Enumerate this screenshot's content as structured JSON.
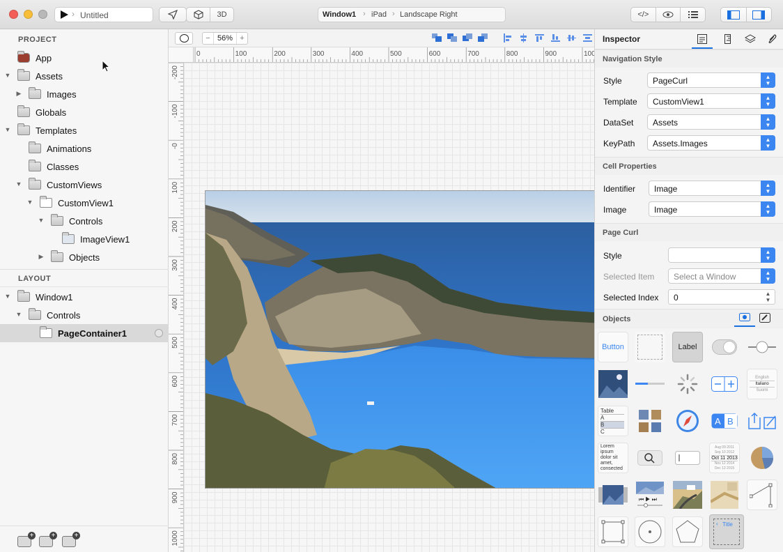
{
  "titlebar": {
    "document": "Untitled",
    "mode_3d": "3D",
    "breadcrumb": [
      "Window1",
      "iPad",
      "Landscape Right"
    ]
  },
  "left": {
    "project_header": "PROJECT",
    "layout_header": "LAYOUT",
    "project_items": [
      {
        "label": "App",
        "indent": 0,
        "tri": ""
      },
      {
        "label": "Assets",
        "indent": 0,
        "tri": "down"
      },
      {
        "label": "Images",
        "indent": 1,
        "tri": "right"
      },
      {
        "label": "Globals",
        "indent": 0,
        "tri": ""
      },
      {
        "label": "Templates",
        "indent": 0,
        "tri": "down"
      },
      {
        "label": "Animations",
        "indent": 1,
        "tri": ""
      },
      {
        "label": "Classes",
        "indent": 1,
        "tri": ""
      },
      {
        "label": "CustomViews",
        "indent": 1,
        "tri": "down"
      },
      {
        "label": "CustomView1",
        "indent": 2,
        "tri": "down"
      },
      {
        "label": "Controls",
        "indent": 3,
        "tri": "down"
      },
      {
        "label": "ImageView1",
        "indent": 4,
        "tri": ""
      },
      {
        "label": "Objects",
        "indent": 3,
        "tri": "right"
      }
    ],
    "layout_items": [
      {
        "label": "Window1",
        "indent": 0,
        "tri": "down"
      },
      {
        "label": "Controls",
        "indent": 1,
        "tri": "down"
      },
      {
        "label": "PageContainer1",
        "indent": 2,
        "tri": "",
        "selected": true
      }
    ]
  },
  "canvas": {
    "zoom": "56%",
    "ruler_top": [
      "0",
      "100",
      "200",
      "300",
      "400",
      "500",
      "600",
      "700",
      "800",
      "900",
      "100"
    ],
    "ruler_left": [
      "-200",
      "-100",
      "-0",
      "100",
      "200",
      "300",
      "400",
      "500",
      "600",
      "700",
      "800",
      "900",
      "1000"
    ]
  },
  "inspector": {
    "title": "Inspector",
    "nav_style_header": "Navigation Style",
    "nav_props": [
      {
        "label": "Style",
        "value": "PageCurl"
      },
      {
        "label": "Template",
        "value": "CustomView1"
      },
      {
        "label": "DataSet",
        "value": "Assets"
      },
      {
        "label": "KeyPath",
        "value": "Assets.Images"
      }
    ],
    "cell_header": "Cell Properties",
    "cell_props": [
      {
        "label": "Identifier",
        "value": "Image"
      },
      {
        "label": "Image",
        "value": "Image"
      }
    ],
    "curl_header": "Page Curl",
    "curl_props": [
      {
        "label": "Style",
        "value": ""
      },
      {
        "label": "Selected Item",
        "value": "Select a Window"
      },
      {
        "label": "Selected Index",
        "value": "0"
      }
    ],
    "objects_header": "Objects",
    "objects": {
      "button_label": "Button",
      "label_label": "Label",
      "table_lines": [
        "Table",
        "A",
        "B",
        "C"
      ],
      "picker_lines": [
        "English",
        "Italiano",
        "Suomi"
      ],
      "lorem_text": "Lorem ipsum dolor sit amet, consected",
      "date_lines": [
        "Aug 09 2011",
        "Sep 10 2012",
        "Oct 11 2013",
        "Nov 12 2014",
        "Dec 13 2015"
      ],
      "title_text": "Title"
    }
  },
  "colors": {
    "accent": "#3b86f0",
    "selection": "#d9d9d9"
  }
}
